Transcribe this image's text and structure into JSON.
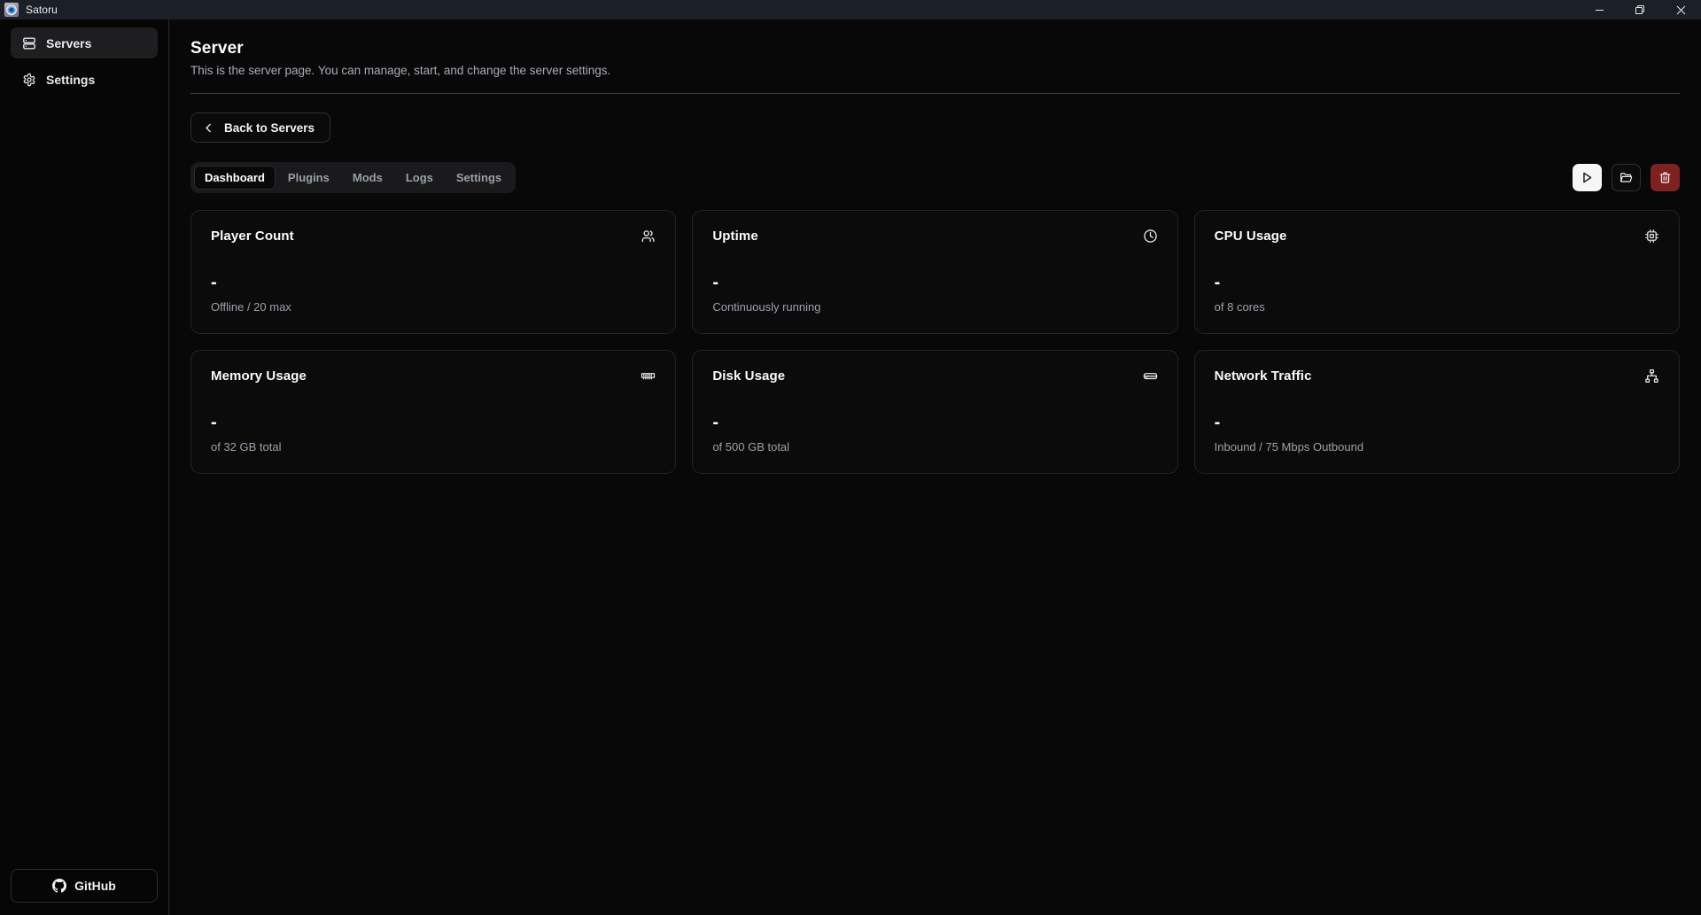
{
  "window": {
    "app_icon": "satoru-app-icon",
    "title": "Satoru",
    "controls": {
      "minimize": "minimize-icon",
      "maximize": "maximize-restore-icon",
      "close": "close-icon"
    }
  },
  "sidebar": {
    "items": [
      {
        "label": "Servers",
        "icon": "server-icon",
        "active": true
      },
      {
        "label": "Settings",
        "icon": "gear-icon",
        "active": false
      }
    ],
    "footer": {
      "label": "GitHub",
      "icon": "github-icon"
    }
  },
  "header": {
    "title": "Server",
    "subtitle": "This is the server page. You can manage, start, and change the server settings."
  },
  "back_button": {
    "label": "Back to Servers",
    "icon": "chevron-left-icon"
  },
  "tabs": [
    {
      "label": "Dashboard",
      "active": true
    },
    {
      "label": "Plugins",
      "active": false
    },
    {
      "label": "Mods",
      "active": false
    },
    {
      "label": "Logs",
      "active": false
    },
    {
      "label": "Settings",
      "active": false
    }
  ],
  "actions": [
    {
      "name": "start-server",
      "icon": "play-icon",
      "style": "primary"
    },
    {
      "name": "open-folder",
      "icon": "folder-icon",
      "style": "ghost"
    },
    {
      "name": "delete-server",
      "icon": "trash-icon",
      "style": "danger"
    }
  ],
  "cards": [
    {
      "title": "Player Count",
      "icon": "users-icon",
      "value": "-",
      "subtitle": "Offline / 20 max"
    },
    {
      "title": "Uptime",
      "icon": "clock-icon",
      "value": "-",
      "subtitle": "Continuously running"
    },
    {
      "title": "CPU Usage",
      "icon": "cpu-icon",
      "value": "-",
      "subtitle": "of 8 cores"
    },
    {
      "title": "Memory Usage",
      "icon": "memory-icon",
      "value": "-",
      "subtitle": "of 32 GB total"
    },
    {
      "title": "Disk Usage",
      "icon": "harddrive-icon",
      "value": "-",
      "subtitle": "of 500 GB total"
    },
    {
      "title": "Network Traffic",
      "icon": "network-icon",
      "value": "-",
      "subtitle": "Inbound / 75 Mbps Outbound"
    }
  ],
  "colors": {
    "app_background": "#080809",
    "titlebar": "#1b2027",
    "card_background": "#0b0b0c",
    "card_border": "#232326",
    "accent_primary": "#f7f7f8",
    "danger": "#7d2121",
    "muted_text": "#9ba1a9"
  }
}
